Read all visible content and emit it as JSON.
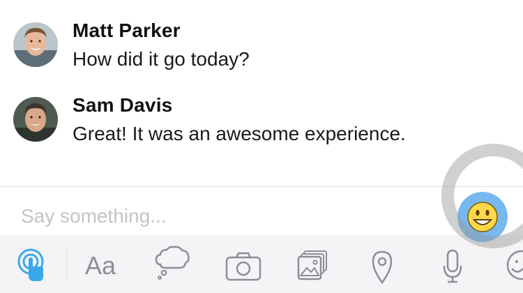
{
  "conversation": {
    "messages": [
      {
        "sender": "Matt Parker",
        "text": "How did it go today?",
        "avatar_icon": "avatar-matt-icon"
      },
      {
        "sender": "Sam Davis",
        "text": "Great! It was an awesome experience.",
        "avatar_icon": "avatar-sam-icon"
      }
    ]
  },
  "composer": {
    "placeholder": "Say something...",
    "value": "",
    "quick_emoji_icon": "smiley-emoji-icon"
  },
  "toolbar": {
    "items": [
      {
        "name": "touch-icon",
        "active": true
      },
      {
        "name": "text-format",
        "label": "Aa"
      },
      {
        "name": "thought-bubble-icon"
      },
      {
        "name": "camera-icon"
      },
      {
        "name": "gallery-icon"
      },
      {
        "name": "location-pin-icon"
      },
      {
        "name": "microphone-icon"
      },
      {
        "name": "emoji-icon"
      }
    ]
  },
  "colors": {
    "accent_blue": "#3aa7ea",
    "icon_gray": "#8a8e96",
    "toolbar_bg": "#f4f4f6",
    "placeholder_gray": "#c4c4c8",
    "like_button_bg": "#78b8ee",
    "emoji_yellow": "#ffd84a"
  }
}
